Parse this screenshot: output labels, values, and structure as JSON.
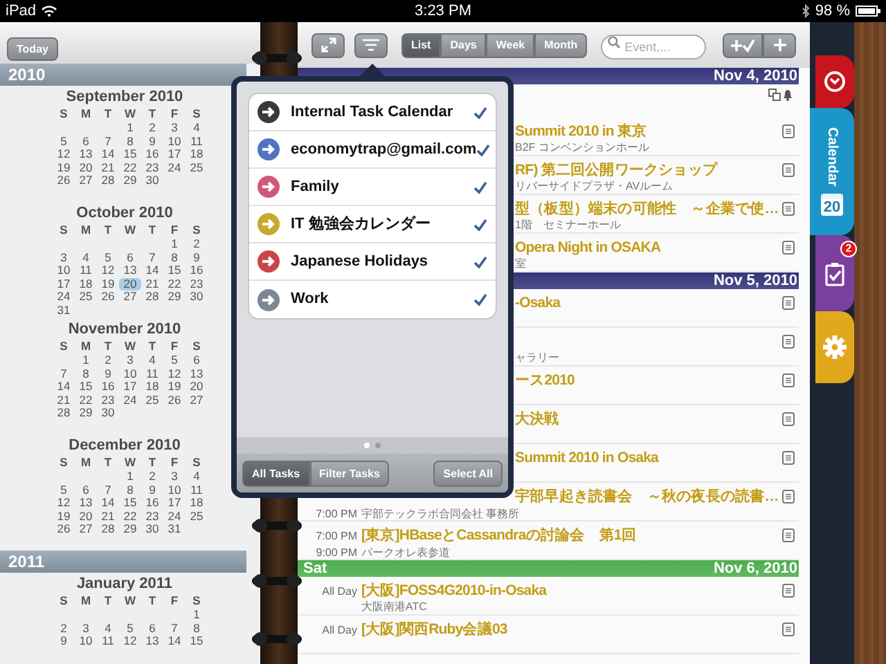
{
  "status_bar": {
    "device": "iPad",
    "time": "3:23 PM",
    "battery": "98 %"
  },
  "left_page": {
    "today_button": "Today",
    "years": [
      {
        "year": "2010",
        "months": [
          {
            "title": "September 2010",
            "weekdays": [
              "S",
              "M",
              "T",
              "W",
              "T",
              "F",
              "S"
            ],
            "weeks": [
              [
                "1",
                "2",
                "3",
                "4"
              ],
              [
                "5",
                "6",
                "7",
                "8",
                "9",
                "10",
                "11"
              ],
              [
                "12",
                "13",
                "14",
                "15",
                "16",
                "17",
                "18"
              ],
              [
                "19",
                "20",
                "21",
                "22",
                "23",
                "24",
                "25"
              ],
              [
                "26",
                "27",
                "28",
                "29",
                "30"
              ]
            ]
          },
          {
            "title": "October 2010",
            "weekdays": [
              "S",
              "M",
              "T",
              "W",
              "T",
              "F",
              "S"
            ],
            "weeks": [
              [
                "1",
                "2"
              ],
              [
                "3",
                "4",
                "5",
                "6",
                "7",
                "8",
                "9"
              ],
              [
                "10",
                "11",
                "12",
                "13",
                "14",
                "15",
                "16"
              ],
              [
                "17",
                "18",
                "19",
                {
                  "day": "20",
                  "selected": true
                },
                "21",
                "22",
                "23"
              ],
              [
                "24",
                "25",
                "26",
                "27",
                "28",
                "29",
                "30"
              ],
              [
                "31"
              ]
            ]
          },
          {
            "title": "November 2010",
            "weekdays": [
              "S",
              "M",
              "T",
              "W",
              "T",
              "F",
              "S"
            ],
            "weeks": [
              [
                "1",
                "2",
                "3",
                "4",
                "5",
                "6"
              ],
              [
                "7",
                "8",
                "9",
                "10",
                "11",
                "12",
                "13"
              ],
              [
                "14",
                "15",
                "16",
                "17",
                "18",
                "19",
                "20"
              ],
              [
                "21",
                "22",
                "23",
                "24",
                "25",
                "26",
                "27"
              ],
              [
                "28",
                "29",
                "30"
              ]
            ]
          },
          {
            "title": "December 2010",
            "weekdays": [
              "S",
              "M",
              "T",
              "W",
              "T",
              "F",
              "S"
            ],
            "weeks": [
              [
                "1",
                "2",
                "3",
                "4"
              ],
              [
                "5",
                "6",
                "7",
                "8",
                "9",
                "10",
                "11"
              ],
              [
                "12",
                "13",
                "14",
                "15",
                "16",
                "17",
                "18"
              ],
              [
                "19",
                "20",
                "21",
                "22",
                "23",
                "24",
                "25"
              ],
              [
                "26",
                "27",
                "28",
                "29",
                "30",
                "31"
              ]
            ]
          }
        ]
      },
      {
        "year": "2011",
        "months": [
          {
            "title": "January 2011",
            "weekdays": [
              "S",
              "M",
              "T",
              "W",
              "T",
              "F",
              "S"
            ],
            "weeks": [
              [
                "1"
              ],
              [
                "2",
                "3",
                "4",
                "5",
                "6",
                "7",
                "8"
              ],
              [
                "9",
                "10",
                "11",
                "12",
                "13",
                "14",
                "15"
              ]
            ]
          }
        ]
      }
    ]
  },
  "toolbar": {
    "views": [
      {
        "label": "List",
        "selected": true
      },
      {
        "label": "Days",
        "selected": false
      },
      {
        "label": "Week",
        "selected": false
      },
      {
        "label": "Month",
        "selected": false
      }
    ],
    "search": {
      "placeholder": "Event,..."
    }
  },
  "days": [
    {
      "date": "Nov 4, 2010",
      "color": "#34347a",
      "alert_icons": true,
      "events": [
        {
          "title": "Summit 2010 in 東京",
          "location": "B2F コンベンションホール",
          "title_cut": true,
          "location_cut": true
        },
        {
          "title": "RF) 第二回公開ワークショップ",
          "location": "リバーサイドプラザ・AVルーム",
          "title_cut": true,
          "location_cut": true
        },
        {
          "title": "型（板型）端末の可能性　～企業で使…",
          "location": "1階　セミナーホール",
          "title_cut": true,
          "location_cut": true
        },
        {
          "title": "Opera Night in OSAKA",
          "location": "室",
          "title_cut": true,
          "location_cut": true
        }
      ]
    },
    {
      "date": "Nov 5, 2010",
      "color": "#34347a",
      "events": [
        {
          "title": "-Osaka",
          "title_cut": true
        },
        {
          "location": "ャラリー",
          "location_cut": true
        },
        {
          "title": "ース2010",
          "title_cut": true
        },
        {
          "title": "大決戦",
          "title_cut": true
        },
        {
          "title": "Summit 2010 in Osaka",
          "title_cut": true
        },
        {
          "title": "宇部早起き読書会　～秋の夜長の読書…",
          "end": "7:00 PM",
          "location": "宇部テックラボ合同会社 事務所",
          "title_cut": true
        },
        {
          "start": "7:00 PM",
          "title": "[東京]HBaseとCassandraの討論会　第1回",
          "end": "9:00 PM",
          "location": "パークオレ表参道"
        }
      ]
    },
    {
      "day": "Sat",
      "date": "Nov 6, 2010",
      "color": "#4cae4c",
      "events": [
        {
          "start": "All Day",
          "title": "[大阪]FOSS4G2010-in-Osaka",
          "location": "大阪南港ATC"
        },
        {
          "start": "All Day",
          "title": "[大阪]関西Ruby会議03"
        }
      ]
    }
  ],
  "side_tabs": [
    {
      "kind": "alarm",
      "color": "#c8141c",
      "selected": false
    },
    {
      "kind": "calendar",
      "label": "Calendar",
      "date": "20",
      "color": "#1c95c8",
      "selected": true
    },
    {
      "kind": "tasks",
      "badge": "2",
      "color": "#7b3f9e",
      "selected": false
    },
    {
      "kind": "settings",
      "color": "#e0a81c",
      "selected": false
    }
  ],
  "popover": {
    "calendars": [
      {
        "label": "Internal Task Calendar",
        "color": "#3a3a3a",
        "checked": true
      },
      {
        "label": "economytrap@gmail.com",
        "color": "#4f74c0",
        "checked": true
      },
      {
        "label": "Family",
        "color": "#d0597a",
        "checked": true
      },
      {
        "label": "IT 勉強会カレンダー",
        "color": "#c9a82c",
        "checked": true
      },
      {
        "label": "Japanese Holidays",
        "color": "#c8464a",
        "checked": true
      },
      {
        "label": "Work",
        "color": "#7d8794",
        "checked": true
      }
    ],
    "pages": [
      {
        "selected": true
      },
      {
        "selected": false
      }
    ],
    "modes": [
      {
        "label": "All Tasks",
        "selected": true
      },
      {
        "label": "Filter Tasks",
        "selected": false
      }
    ],
    "select_all": "Select All"
  }
}
